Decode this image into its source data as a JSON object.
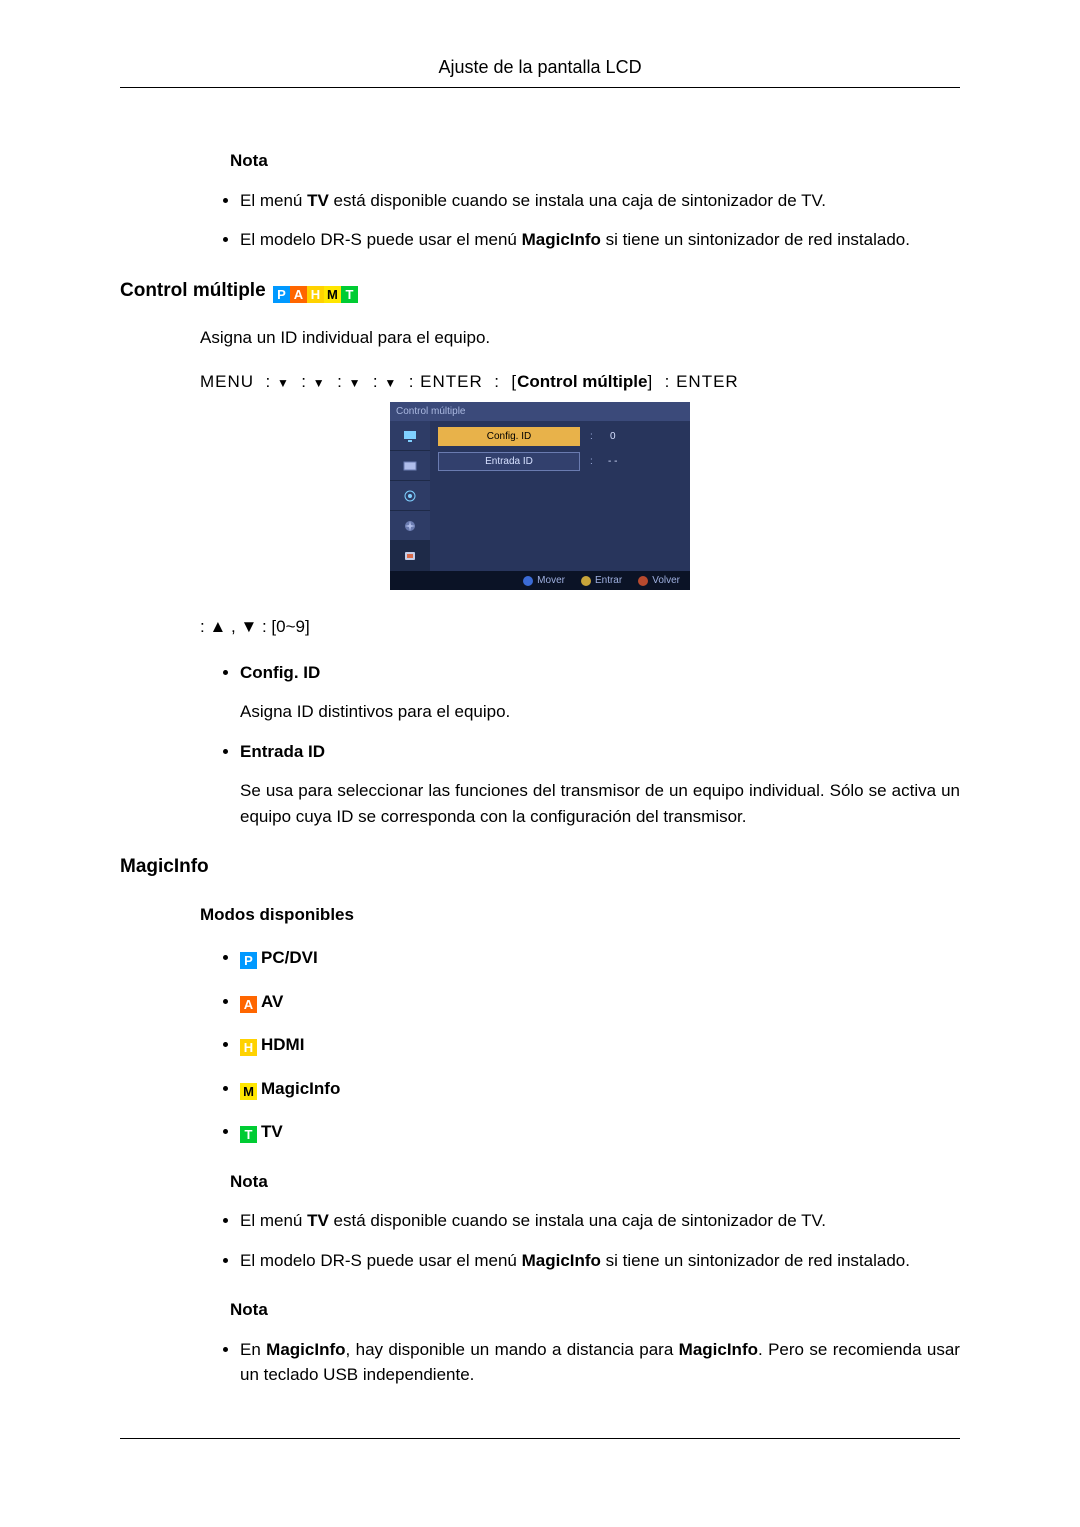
{
  "header": {
    "title": "Ajuste de la pantalla LCD"
  },
  "note_label": "Nota",
  "notes_top": [
    {
      "pre": "El menú ",
      "b1": "TV",
      "mid": " está disponible cuando se instala una caja de sintonizador de TV.",
      "b2": "",
      "post": ""
    },
    {
      "pre": "El modelo DR-S puede usar el menú ",
      "b1": "MagicInfo",
      "mid": " si tiene un sintonizador de red instalado.",
      "b2": "",
      "post": ""
    }
  ],
  "section_control": {
    "title": "Control múltiple",
    "badges": [
      "P",
      "A",
      "H",
      "M",
      "T"
    ],
    "desc": "Asigna un ID individual para el equipo.",
    "menu_path": {
      "menu": "MENU",
      "enter": "ENTER",
      "label_bold": "Control múltiple"
    },
    "nav_line": ": ▲ , ▼  : [0~9]",
    "items": [
      {
        "title": "Config. ID",
        "desc": "Asigna ID distintivos para el equipo."
      },
      {
        "title": "Entrada ID",
        "desc": "Se usa para seleccionar las funciones del transmisor de un equipo individual. Sólo se activa un equipo cuya ID se corresponda con la configuración del transmisor."
      }
    ]
  },
  "osd": {
    "title": "Control múltiple",
    "rows": [
      {
        "label": "Config. ID",
        "value": "0",
        "selected": true
      },
      {
        "label": "Entrada ID",
        "value": "- -",
        "selected": false
      }
    ],
    "footer": {
      "move": "Mover",
      "enter": "Entrar",
      "back": "Volver"
    }
  },
  "section_magic": {
    "title": "MagicInfo",
    "subtitle": "Modos disponibles",
    "modes": [
      {
        "badge": "P",
        "cls": "bg-p",
        "label": "PC/DVI"
      },
      {
        "badge": "A",
        "cls": "bg-a",
        "label": "AV"
      },
      {
        "badge": "H",
        "cls": "bg-h",
        "label": "HDMI"
      },
      {
        "badge": "M",
        "cls": "bg-m",
        "label": "MagicInfo"
      },
      {
        "badge": "T",
        "cls": "bg-t",
        "label": "TV"
      }
    ],
    "notes1": [
      {
        "pre": "El menú ",
        "b1": "TV",
        "mid": " está disponible cuando se instala una caja de sintonizador de TV.",
        "b2": "",
        "post": ""
      },
      {
        "pre": "El modelo DR-S puede usar el menú ",
        "b1": "MagicInfo",
        "mid": " si tiene un sintonizador de red instalado.",
        "b2": "",
        "post": ""
      }
    ],
    "notes2": [
      {
        "pre": "En ",
        "b1": "MagicInfo",
        "mid": ", hay disponible un mando a distancia para ",
        "b2": "MagicInfo",
        "post": ". Pero se recomienda usar un teclado USB independiente."
      }
    ]
  }
}
